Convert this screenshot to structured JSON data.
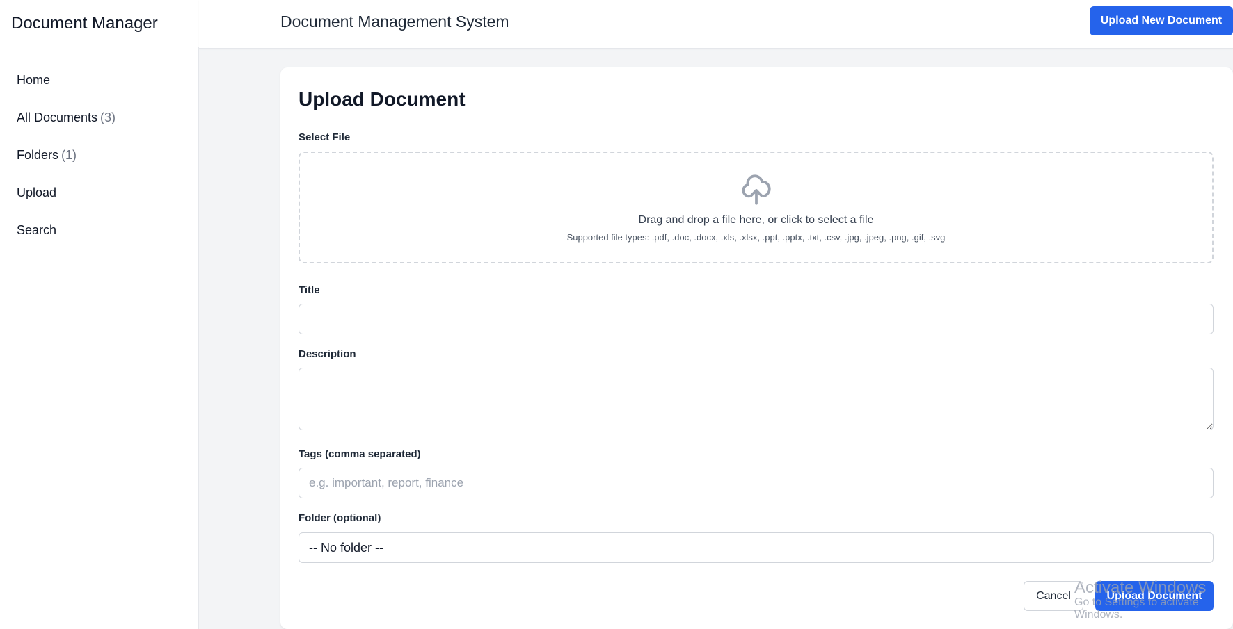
{
  "app": {
    "title": "Document Manager"
  },
  "header": {
    "title": "Document Management System",
    "upload_button": "Upload New Document"
  },
  "sidebar": {
    "items": [
      {
        "label": "Home",
        "count": ""
      },
      {
        "label": "All Documents",
        "count": "(3)"
      },
      {
        "label": "Folders",
        "count": "(1)"
      },
      {
        "label": "Upload",
        "count": ""
      },
      {
        "label": "Search",
        "count": ""
      }
    ]
  },
  "form": {
    "heading": "Upload Document",
    "file": {
      "label": "Select File",
      "drop_text": "Drag and drop a file here, or click to select a file",
      "supported_types": "Supported file types: .pdf, .doc, .docx, .xls, .xlsx, .ppt, .pptx, .txt, .csv, .jpg, .jpeg, .png, .gif, .svg",
      "icon": "cloud-upload-icon"
    },
    "title": {
      "label": "Title",
      "value": "",
      "placeholder": ""
    },
    "description": {
      "label": "Description",
      "value": "",
      "placeholder": ""
    },
    "tags": {
      "label": "Tags (comma separated)",
      "value": "",
      "placeholder": "e.g. important, report, finance"
    },
    "folder": {
      "label": "Folder (optional)",
      "selected": "-- No folder --"
    },
    "cancel_button": "Cancel",
    "submit_button": "Upload Document"
  },
  "watermark": {
    "title": "Activate Windows",
    "subtitle": "Go to Settings to activate Windows."
  },
  "colors": {
    "primary": "#2563eb",
    "background": "#f3f4f6",
    "border": "#d1d5db"
  }
}
